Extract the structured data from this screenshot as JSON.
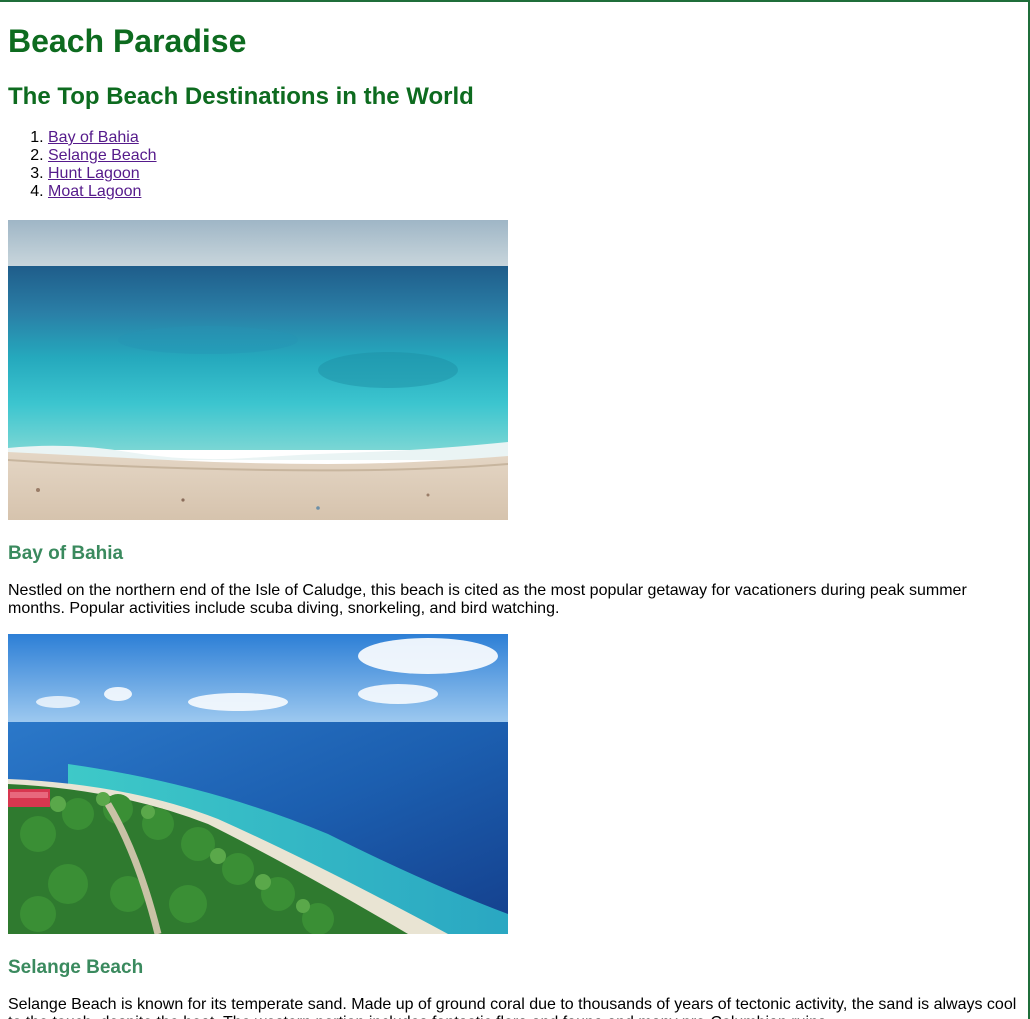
{
  "header": {
    "title": "Beach Paradise",
    "subtitle": "The Top Beach Destinations in the World"
  },
  "toc": {
    "items": [
      {
        "label": "Bay of Bahia"
      },
      {
        "label": "Selange Beach"
      },
      {
        "label": "Hunt Lagoon"
      },
      {
        "label": "Moat Lagoon"
      }
    ]
  },
  "destinations": [
    {
      "name": "Bay of Bahia",
      "description": "Nestled on the northern end of the Isle of Caludge, this beach is cited as the most popular getaway for vacationers during peak summer months. Popular activities include scuba diving, snorkeling, and bird watching."
    },
    {
      "name": "Selange Beach",
      "description": "Selange Beach is known for its temperate sand. Made up of ground coral due to thousands of years of tectonic activity, the sand is always cool to the touch, despite the heat. The western portion includes fantastic flora and fauna and many pre-Columbian ruins."
    }
  ],
  "colors": {
    "heading": "#0d6b1f",
    "section_heading": "#3a8a5e",
    "visited_link": "#551a8b"
  }
}
